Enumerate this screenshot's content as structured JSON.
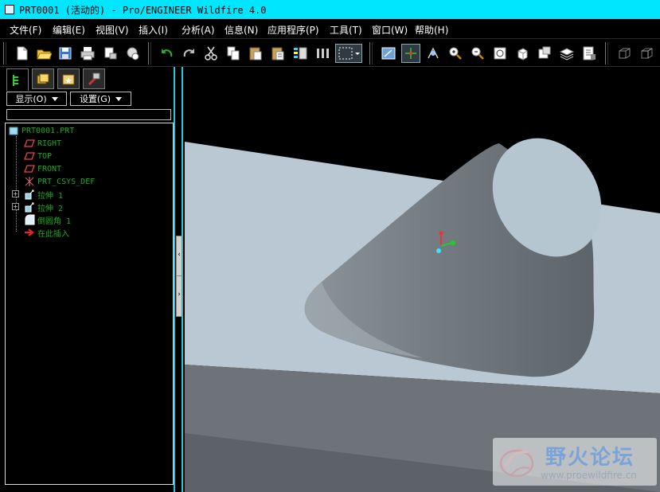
{
  "window": {
    "title": "PRT0001 (活动的) - Pro/ENGINEER Wildfire 4.0"
  },
  "menu": [
    {
      "label": "文件(F)"
    },
    {
      "label": "编辑(E)"
    },
    {
      "label": "视图(V)"
    },
    {
      "label": "插入(I)"
    },
    {
      "label": "分析(A)"
    },
    {
      "label": "信息(N)"
    },
    {
      "label": "应用程序(P)"
    },
    {
      "label": "工具(T)"
    },
    {
      "label": "窗口(W)"
    },
    {
      "label": "帮助(H)"
    }
  ],
  "toolbar_icons": [
    "new-file-icon",
    "open-folder-icon",
    "save-icon",
    "print-icon",
    "send-mail-icon",
    "erase-icon",
    "undo-icon",
    "redo-icon",
    "cut-icon",
    "copy-icon",
    "paste-icon",
    "paste-special-icon",
    "regenerate-icon",
    "model-player-icon",
    "selection-box-icon",
    "repaint-icon",
    "spin-center-icon",
    "orient-icon",
    "zoom-in-icon",
    "zoom-out-icon",
    "refit-icon",
    "reorient-icon",
    "saved-views-icon",
    "layers-icon",
    "view-manager-icon",
    "wireframe-icon",
    "hidden-line-icon"
  ],
  "panel": {
    "tabs": [
      "model-tree-tab-icon",
      "folder-browser-tab-icon",
      "favorites-tab-icon",
      "connections-tab-icon"
    ],
    "show_button": "显示(O)",
    "settings_button": "设置(G)",
    "search_value": ""
  },
  "tree": [
    {
      "label": "PRT0001.PRT",
      "icon": "part-icon",
      "color": "#1fa81f"
    },
    {
      "label": "RIGHT",
      "icon": "datum-plane-icon",
      "color": "#1fa81f"
    },
    {
      "label": "TOP",
      "icon": "datum-plane-icon",
      "color": "#1fa81f"
    },
    {
      "label": "FRONT",
      "icon": "datum-plane-icon",
      "color": "#1fa81f"
    },
    {
      "label": "PRT_CSYS_DEF",
      "icon": "coordinate-system-icon",
      "color": "#1fa81f"
    },
    {
      "label": "拉伸 1",
      "icon": "extrude-icon",
      "color": "#1fa81f"
    },
    {
      "label": "拉伸 2",
      "icon": "extrude-icon",
      "color": "#1fa81f"
    },
    {
      "label": "倒圆角 1",
      "icon": "round-icon",
      "color": "#1fa81f"
    },
    {
      "label": "在此插入",
      "icon": "insert-here-arrow-icon",
      "color": "#1fa81f"
    }
  ],
  "watermark": {
    "title": "野火论坛",
    "url": "www.proewildfire.cn"
  },
  "colors": {
    "background": "#000000",
    "titlebar": "#00e6ff",
    "model_top": "#b9c8d2",
    "model_side": "#6d7378",
    "cone": "#7f878d",
    "tree_text": "#1fa81f",
    "splitter": "#20c7d6"
  }
}
